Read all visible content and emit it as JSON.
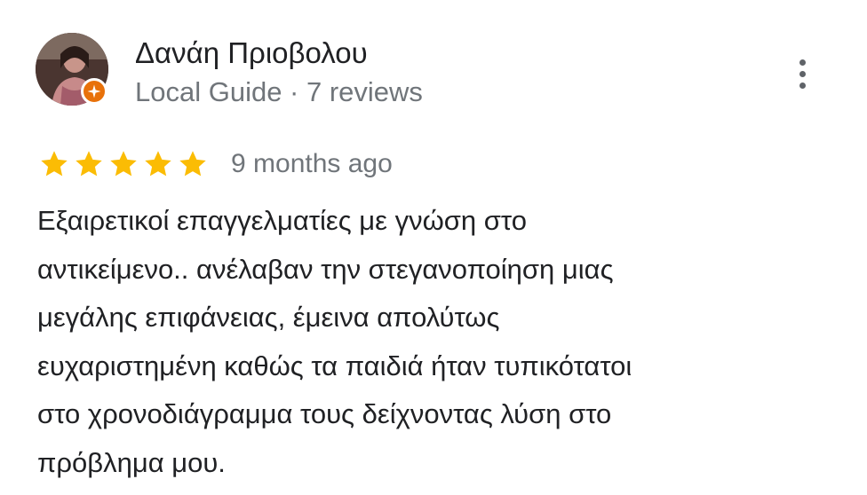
{
  "reviewer": {
    "name": "Δανάη Πριοβολου",
    "meta": "Local Guide · 7 reviews"
  },
  "icons": {
    "avatar": "profile-photo",
    "badge": "local-guide-badge-icon",
    "more": "more-vert-icon",
    "star": "star-icon"
  },
  "colors": {
    "star": "#fbbc04",
    "badge": "#e8710a",
    "text": "#202124",
    "secondary_text": "#70757a"
  },
  "review": {
    "rating": 5,
    "rating_max": 5,
    "date": "9 months ago",
    "text_lines": [
      "Εξαιρετικοί επαγγελματίες με γνώση στο",
      "αντικείμενο.. ανέλαβαν την στεγανοποίηση μιας",
      "μεγάλης επιφάνειας, έμεινα απολύτως",
      "ευχαριστημένη καθώς τα παιδιά ήταν τυπικότατοι",
      "στο χρονοδιάγραμμα τους δείχνοντας λύση στο",
      "πρόβλημα μου."
    ]
  }
}
